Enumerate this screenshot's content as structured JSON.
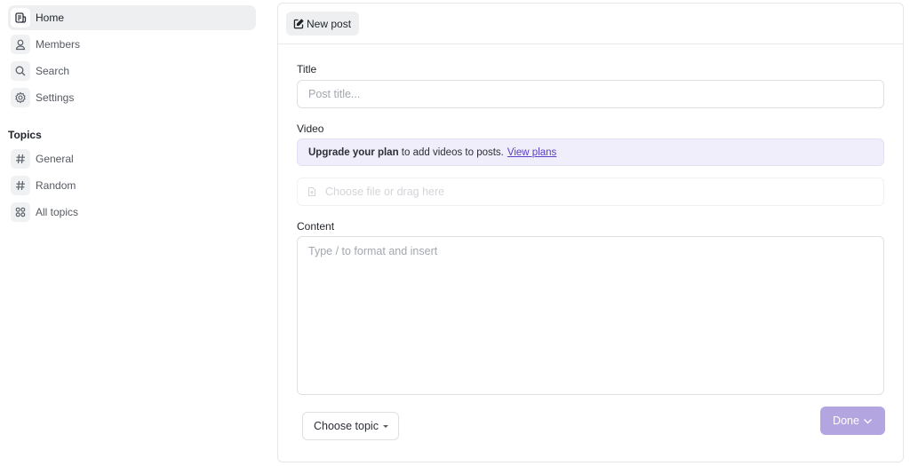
{
  "sidebar": {
    "nav": [
      {
        "label": "Home",
        "icon": "document-icon",
        "active": true
      },
      {
        "label": "Members",
        "icon": "user-icon",
        "active": false
      },
      {
        "label": "Search",
        "icon": "search-icon",
        "active": false
      },
      {
        "label": "Settings",
        "icon": "gear-icon",
        "active": false
      }
    ],
    "topics_title": "Topics",
    "topics": [
      {
        "label": "General",
        "icon": "hash-icon"
      },
      {
        "label": "Random",
        "icon": "hash-icon"
      },
      {
        "label": "All topics",
        "icon": "grid-icon"
      }
    ]
  },
  "header": {
    "new_post_label": "New post"
  },
  "form": {
    "title_label": "Title",
    "title_placeholder": "Post title...",
    "title_value": "",
    "video_label": "Video",
    "upgrade_bold": "Upgrade your plan",
    "upgrade_text": " to add videos to posts.",
    "upgrade_link": "View plans",
    "file_placeholder": "Choose file or drag here",
    "content_label": "Content",
    "content_placeholder": "Type / to format and insert",
    "content_value": "",
    "topic_button": "Choose topic",
    "done_button": "Done"
  },
  "colors": {
    "accent": "#5b3fc4",
    "done_button_bg": "#b3a6e0",
    "banner_bg": "#f1eefb",
    "active_nav_bg": "#eeeff1"
  }
}
